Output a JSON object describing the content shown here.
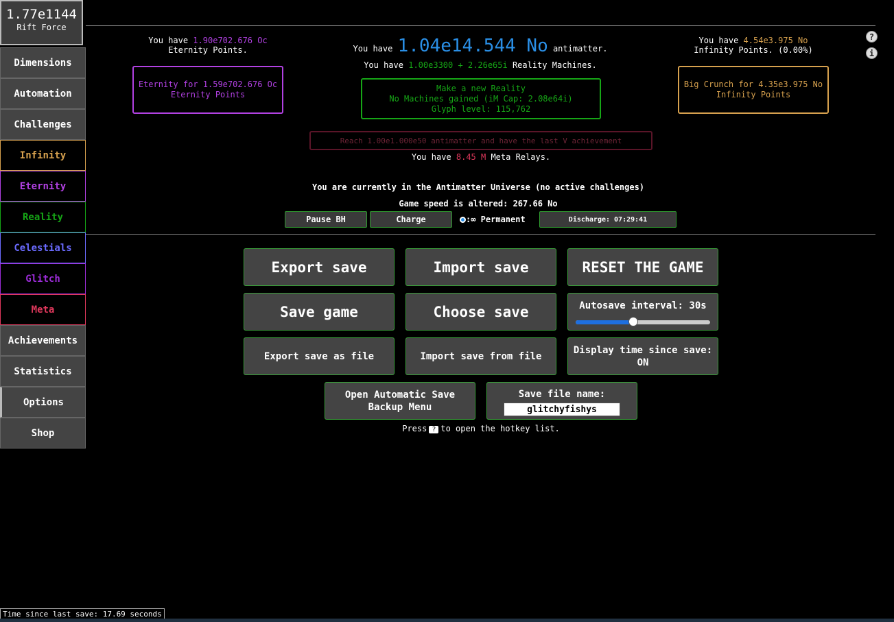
{
  "rift": {
    "value": "1.77e1144",
    "label": "Rift Force"
  },
  "sidebar": {
    "items": [
      {
        "label": "Dimensions",
        "color": "#ffffff"
      },
      {
        "label": "Automation",
        "color": "#ffffff"
      },
      {
        "label": "Challenges",
        "color": "#ffffff"
      },
      {
        "label": "Infinity",
        "color": "#d7a14e"
      },
      {
        "label": "Eternity",
        "color": "#b241e3"
      },
      {
        "label": "Reality",
        "color": "#16a616"
      },
      {
        "label": "Celestials",
        "color": "#6b6bff"
      },
      {
        "label": "Glitch",
        "color": "#9c2cd8"
      },
      {
        "label": "Meta",
        "color": "#e0385c"
      },
      {
        "label": "Achievements",
        "color": "#ffffff"
      },
      {
        "label": "Statistics",
        "color": "#ffffff"
      },
      {
        "label": "Options",
        "color": "#ffffff"
      },
      {
        "label": "Shop",
        "color": "#ffffff"
      }
    ]
  },
  "header": {
    "ep": {
      "pre": "You have ",
      "value": "1.90e702.676 Oc",
      "post": "Eternity Points."
    },
    "am": {
      "pre": "You have ",
      "value": "1.04e14.544 No",
      "post": " antimatter."
    },
    "ip": {
      "pre": "You have ",
      "value": "4.54e3.975 No",
      "post": "Infinity Points. (0.00%)"
    },
    "rm": {
      "pre": "You have ",
      "value": "1.00e3300 + 2.26e65i",
      "post": " Reality Machines."
    },
    "eternity_btn": {
      "line1": "Eternity for 1.59e702.676 Oc",
      "line2": "Eternity Points"
    },
    "reality_btn": {
      "line1": "Make a new Reality",
      "line2": "No Machines gained (iM Cap: 2.08e64i)",
      "line3": "Glyph level: 115,762"
    },
    "crunch_btn": {
      "line1": "Big Crunch for 4.35e3.975 No",
      "line2": "Infinity Points"
    },
    "meta_btn": "Reach 1.00e1.000e50 antimatter and have the last V achievement",
    "meta_relays": {
      "pre": "You have ",
      "value": "8.45 M",
      "post": " Meta Relays."
    },
    "universe": "You are currently in the Antimatter Universe (no active challenges)",
    "speed": "Game speed is altered: 267.66 No",
    "pause_bh": "Pause BH",
    "charge": "Charge",
    "permanent": ":∞ Permanent",
    "discharge": "Discharge: 07:29:41",
    "help_q": "?",
    "help_i": "i"
  },
  "options": {
    "export_save": "Export save",
    "import_save": "Import save",
    "reset": "RESET THE GAME",
    "save_game": "Save game",
    "choose_save": "Choose save",
    "autosave_label": "Autosave interval: 30s",
    "autosave_fraction": 0.43,
    "export_file": "Export save as file",
    "import_file": "Import save from file",
    "display_time_l1": "Display time since save:",
    "display_time_l2": "ON",
    "backup_l1": "Open Automatic Save",
    "backup_l2": "Backup Menu",
    "file_name_label": "Save file name:",
    "file_name_value": "glitchyfishys",
    "hotkey_pre": "Press",
    "hotkey_key": "?",
    "hotkey_post": "to open the hotkey list."
  },
  "status": "Time since last save: 17.69 seconds"
}
